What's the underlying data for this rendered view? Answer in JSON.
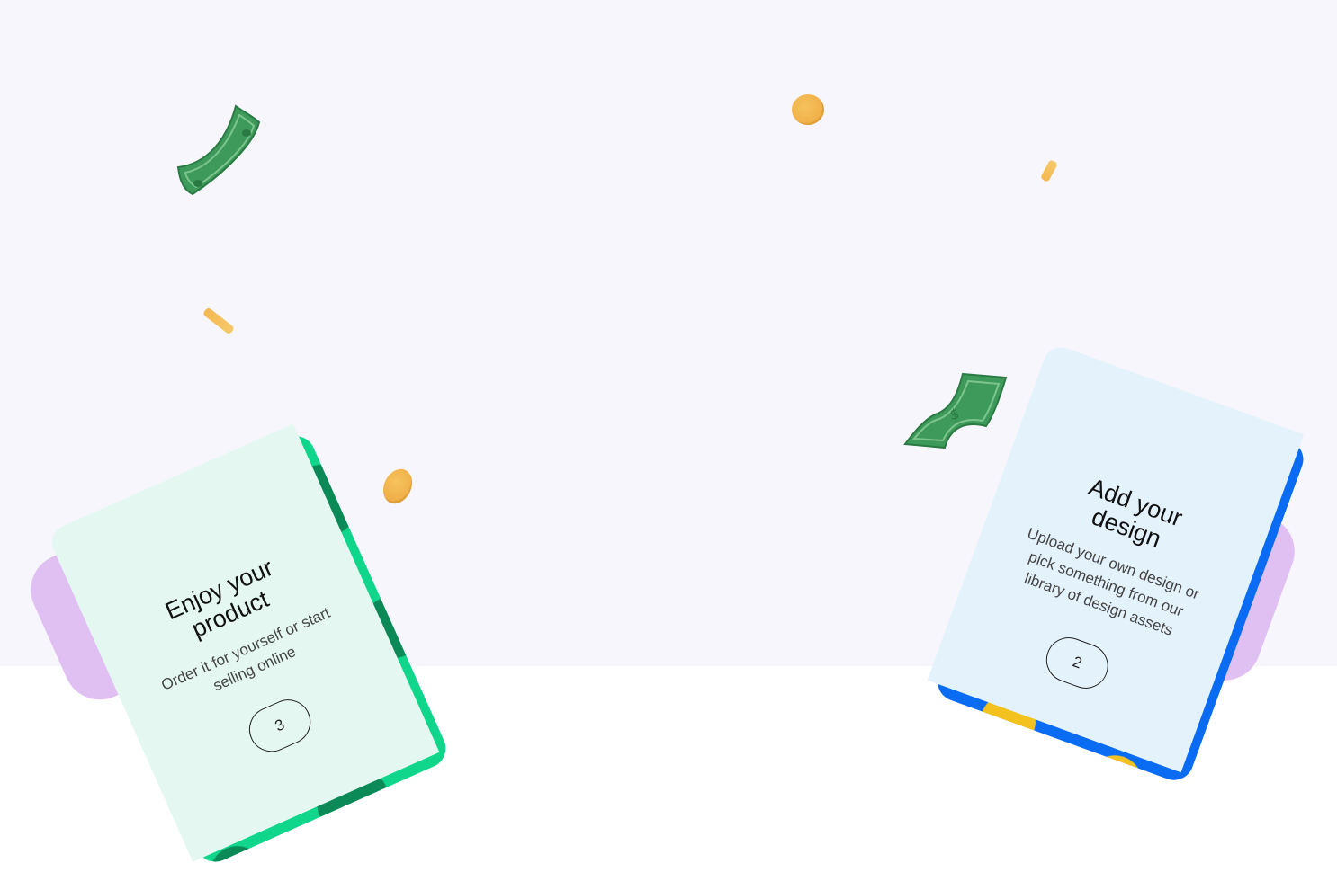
{
  "colors": {
    "hero_background": "#f8f6fd",
    "page_background": "#ffffff",
    "green_card_face": "#e4f8f1",
    "green_card_accent": "#0fd68a",
    "blue_card_face": "#e4f2fc",
    "blue_card_accent": "#0a6cf2",
    "purple_accent": "#e0bff2",
    "coin_gold": "#f1b24a",
    "bill_green": "#3e9a5a"
  },
  "cards": [
    {
      "title": "Enjoy your product",
      "description": "Order it for yourself or start selling online",
      "step": "3"
    },
    {
      "title": "Add your design",
      "description": "Upload your own design or pick something from our library of design assets",
      "step": "2"
    }
  ],
  "decorations": [
    "money-bill-icon",
    "money-bill-icon",
    "coin-icon",
    "coin-icon",
    "coin-icon",
    "coin-icon"
  ]
}
